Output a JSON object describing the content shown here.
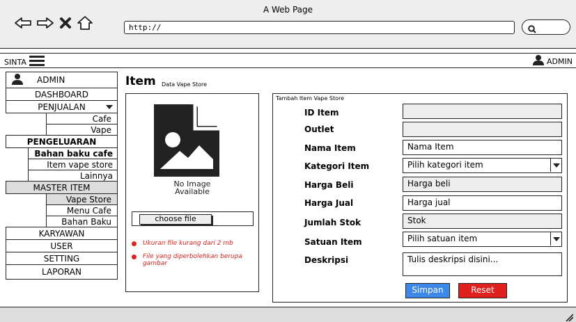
{
  "window": {
    "title": "A Web Page",
    "url": "http://"
  },
  "topbar": {
    "brand": "SINTA",
    "user": "ADMIN"
  },
  "sidebar": {
    "user": "ADMIN",
    "dashboard": "DASHBOARD",
    "penjualan": "PENJUALAN",
    "cafe": "Cafe",
    "vape": "Vape",
    "pengeluaran": "PENGELUARAN",
    "bahan_baku_cafe": "Bahan baku cafe",
    "item_vape_store": "Item vape store",
    "lainnya": "Lainnya",
    "master_item": "MASTER ITEM",
    "vape_store": "Vape Store",
    "menu_cafe": "Menu Cafe",
    "bahan_baku": "Bahan Baku",
    "karyawan": "KARYAWAN",
    "user_menu": "USER",
    "setting": "SETTING",
    "laporan": "LAPORAN"
  },
  "page": {
    "title": "Item",
    "subtitle": "Data Vape Store"
  },
  "image_panel": {
    "no_image_line1": "No Image",
    "no_image_line2": "Available",
    "choose_file": "choose file",
    "note1": "Ukuran file kurang dari 2 mb",
    "note2": "File yang diperbolehkan berupa gambar"
  },
  "form": {
    "title": "Tambah Item Vape Store",
    "id_label": "ID Item",
    "outlet_label": "Outlet",
    "nama_label": "Nama Item",
    "nama_placeholder": "Nama Item",
    "kategori_label": "Kategori Item",
    "kategori_value": "Pilih kategori item",
    "beli_label": "Harga Beli",
    "beli_placeholder": "Harga beli",
    "jual_label": "Harga Jual",
    "jual_placeholder": "Harga jual",
    "stok_label": "Jumlah Stok",
    "stok_placeholder": "Stok",
    "satuan_label": "Satuan Item",
    "satuan_value": "Pilih satuan item",
    "deskripsi_label": "Deskripsi",
    "deskripsi_placeholder": "Tulis deskripsi disini...",
    "save_label": "Simpan",
    "reset_label": "Reset"
  },
  "colors": {
    "save": "#3b88e8",
    "reset": "#e0201e",
    "note": "#e0201e",
    "chrome": "#eeeeee",
    "active": "#dddddd"
  }
}
